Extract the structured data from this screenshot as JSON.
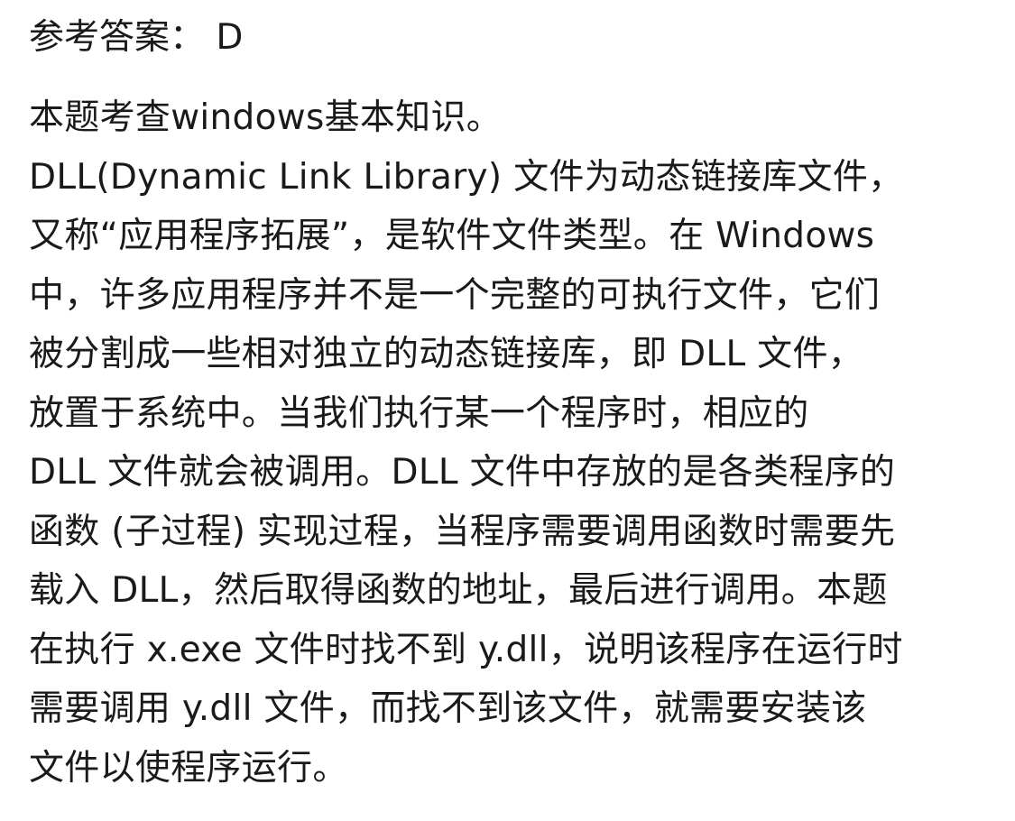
{
  "answer": {
    "text": "参考答案： D"
  },
  "explanation": {
    "lines": [
      "本题考查windows基本知识。",
      "DLL(Dynamic Link Library) 文件为动态链接库文件，",
      "又称“应用程序拓展”，是软件文件类型。在 Windows",
      "中，许多应用程序并不是一个完整的可执行文件，它们",
      "被分割成一些相对独立的动态链接库，即 DLL 文件，",
      "放置于系统中。当我们执行某一个程序时，相应的",
      "DLL 文件就会被调用。DLL 文件中存放的是各类程序的",
      "函数 (子过程) 实现过程，当程序需要调用函数时需要先",
      "载入 DLL，然后取得函数的地址，最后进行调用。本题",
      "在执行 x.exe 文件时找不到 y.dll，说明该程序在运行时",
      "需要调用 y.dll 文件，而找不到该文件，就需要安装该",
      "文件以使程序运行。"
    ]
  }
}
